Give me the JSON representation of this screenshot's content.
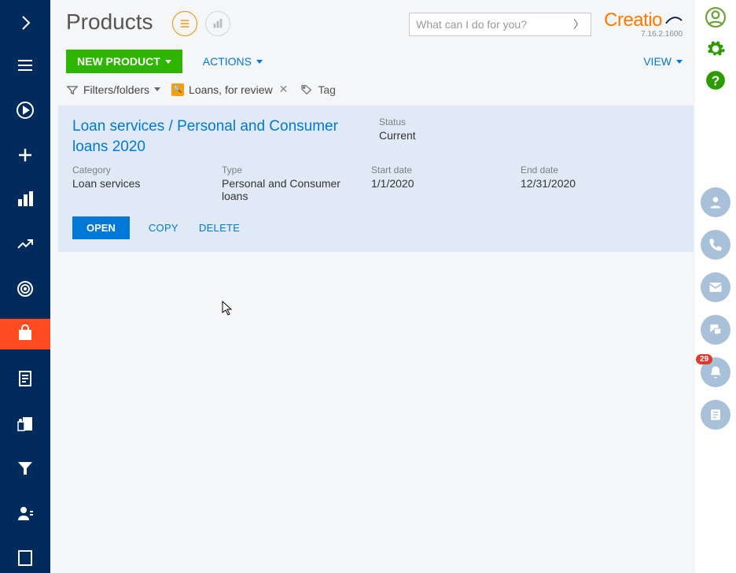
{
  "header": {
    "title": "Products",
    "search_placeholder": "What can I do for you?",
    "brand": "Creatio",
    "version": "7.16.2.1600"
  },
  "toolbar": {
    "new_label": "NEW PRODUCT",
    "actions_label": "ACTIONS",
    "view_label": "VIEW"
  },
  "filterbar": {
    "filters_label": "Filters/folders",
    "folder_name": "Loans, for review",
    "tag_label": "Tag"
  },
  "record": {
    "title": "Loan services / Personal and Consumer loans 2020",
    "status_label": "Status",
    "status_value": "Current",
    "category_label": "Category",
    "category_value": "Loan services",
    "type_label": "Type",
    "type_value": "Personal and Consumer loans",
    "start_label": "Start date",
    "start_value": "1/1/2020",
    "end_label": "End date",
    "end_value": "12/31/2020",
    "open_label": "OPEN",
    "copy_label": "COPY",
    "delete_label": "DELETE"
  },
  "right_rail": {
    "notification_count": "29"
  },
  "colors": {
    "nav_bg": "#002b5c",
    "nav_active": "#ff4b1f",
    "primary_green": "#2db500",
    "link_blue": "#0078d7",
    "brand_orange": "#ff7a00",
    "record_selected_bg": "#e0eaf6",
    "rail_bubble": "#a9c0d9"
  }
}
